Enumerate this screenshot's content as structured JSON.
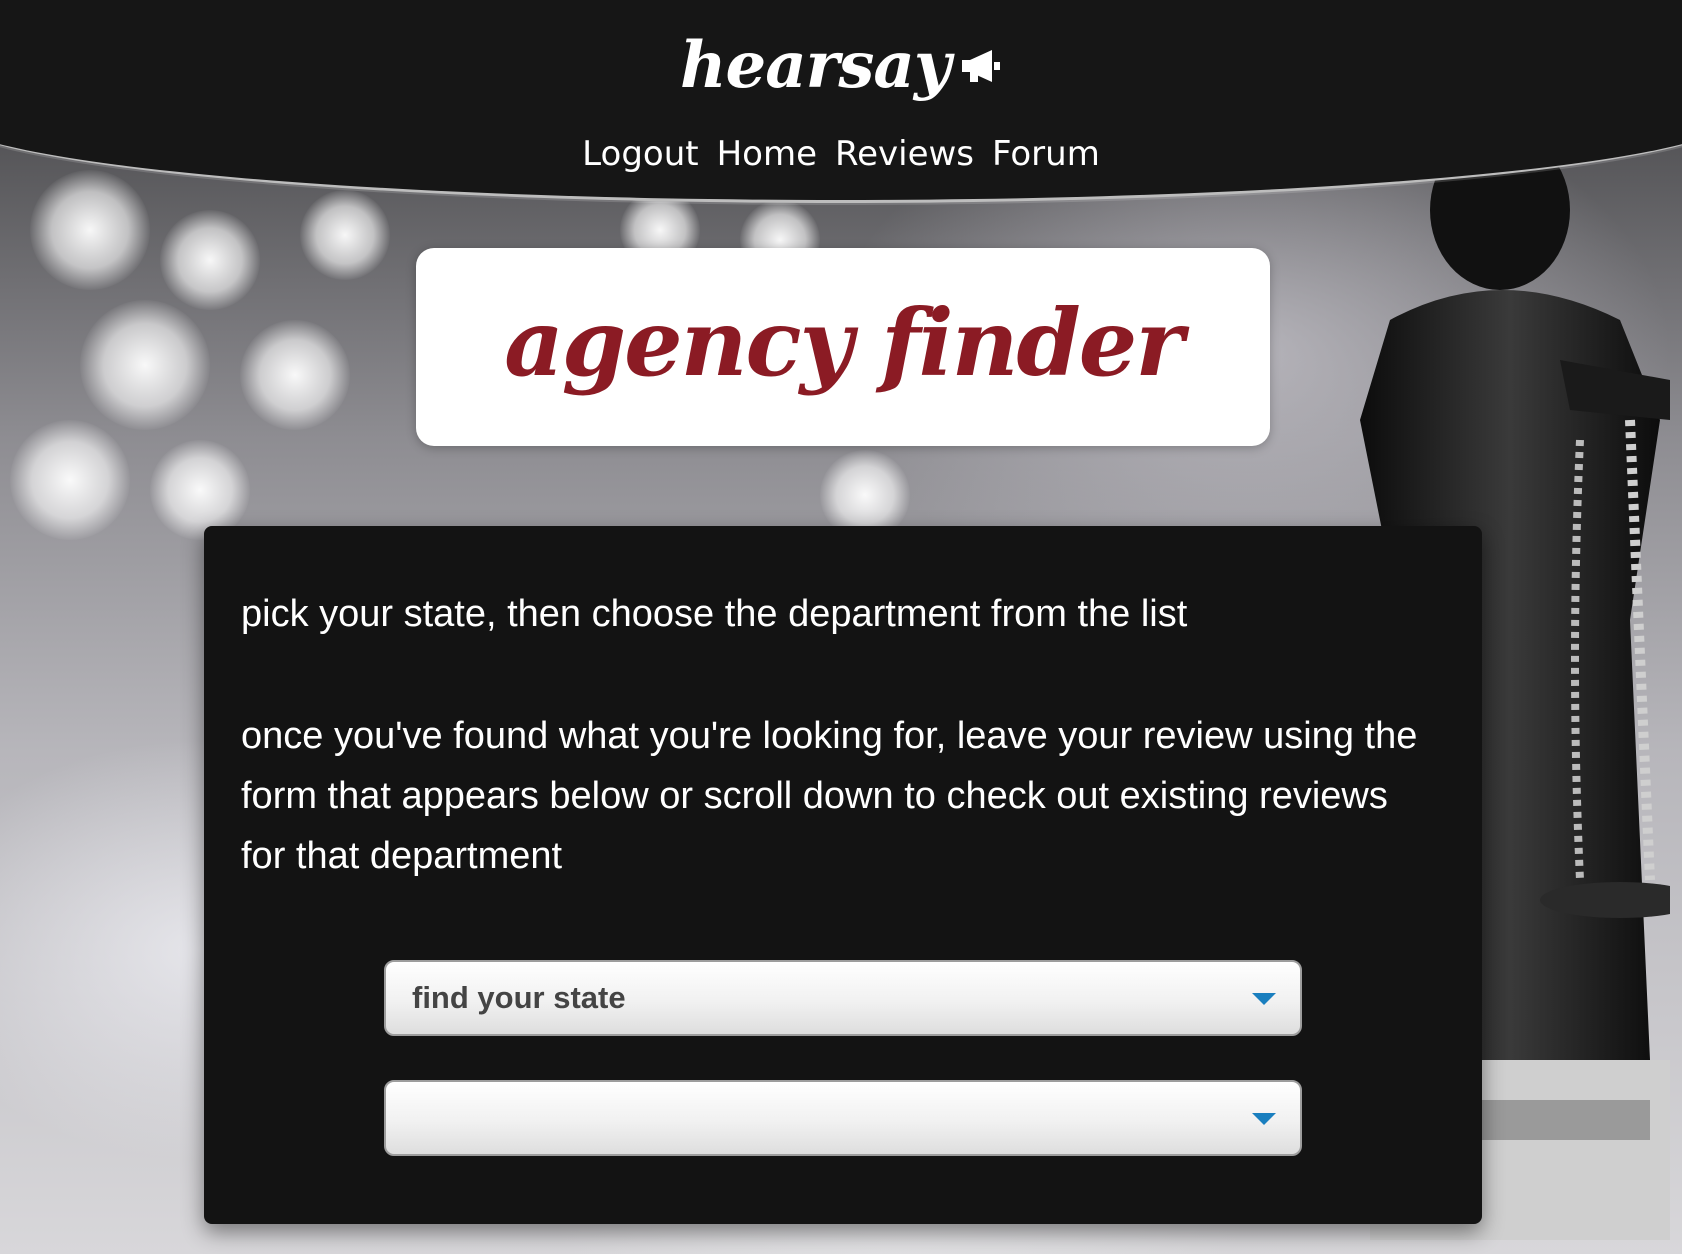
{
  "header": {
    "brand": "hearsay",
    "nav": [
      "Logout",
      "Home",
      "Reviews",
      "Forum"
    ]
  },
  "title_card": {
    "title": "agency finder"
  },
  "panel": {
    "intro": "pick your state, then choose the department from the list",
    "instructions": "once you've found what you're looking for, leave your review using the form that appears below or scroll down to check out existing reviews for that department",
    "state_select": {
      "value": "find your state"
    },
    "department_select": {
      "value": ""
    }
  },
  "colors": {
    "header_bg": "#161616",
    "title_color": "#8b1b24",
    "panel_bg": "#131313",
    "caret_color": "#1a7fbf"
  },
  "icons": {
    "brand_icon": "megaphone-icon",
    "select_caret": "chevron-down-icon"
  }
}
